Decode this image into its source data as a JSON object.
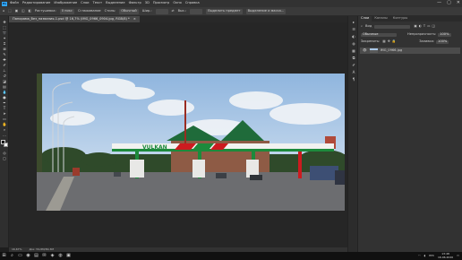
{
  "app": {
    "logo": "Ps"
  },
  "menubar": {
    "items": [
      "Файл",
      "Редактирование",
      "Изображение",
      "Слои",
      "Текст",
      "Выделение",
      "Фильтр",
      "3D",
      "Просмотр",
      "Окно",
      "Справка"
    ]
  },
  "window_controls": [
    "—",
    "▢",
    "✕"
  ],
  "options": {
    "feather_label": "Растушевка:",
    "feather_value": "0 пикс",
    "antialias_label": "Сглаживание",
    "style_label": "Стиль:",
    "style_value": "Обычный",
    "width_label": "Шир.:",
    "height_label": "Выс.:",
    "select_subject": "Выделить предмет",
    "select_mask": "Выделение и маска..."
  },
  "doc_tab": {
    "label": "Панорама_без_названия-1.psd @ 16,7% (IMG_0966_0904.jpg, RGB/8) *",
    "close": "×"
  },
  "status": {
    "zoom": "16,67%",
    "doc": "Док: 59,8M/80,3M"
  },
  "panels": {
    "top_tabs": [
      "Слои",
      "Каналы",
      "Контуры"
    ],
    "kind_label": "Вид",
    "kind_value": "",
    "blend_value": "Обычные",
    "opacity_label": "Непрозрачность:",
    "opacity_value": "100%",
    "lock_label": "Закрепить:",
    "fill_label": "Заливка:",
    "fill_value": "100%",
    "layer_name": "IMG_0966.jpg"
  },
  "taskbar": {
    "start_icon": "windows-icon",
    "search_glyph": "⌕",
    "lang": "РУС",
    "time": "13:48",
    "date": "16.06.2020"
  },
  "canvas": {
    "sign_text": "VULKAN",
    "sky_color": "#a9c7e6",
    "canopy_color": "#f2f2f0",
    "stripe_green": "#1d8a3c",
    "stripe_red": "#cc1b1f",
    "roof_green": "#1f6b3a",
    "asphalt": "#6c6d70"
  }
}
